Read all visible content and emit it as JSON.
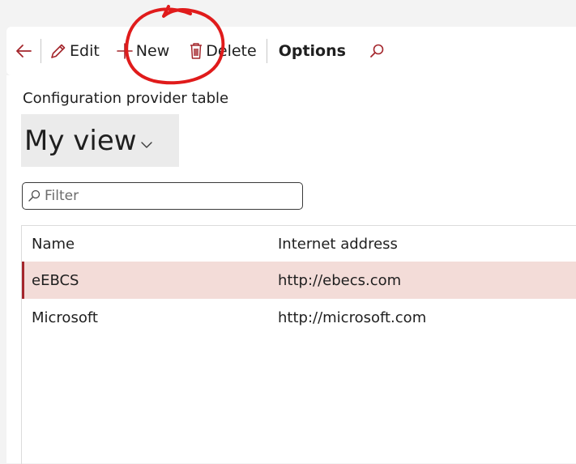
{
  "toolbar": {
    "edit_label": "Edit",
    "new_label": "New",
    "delete_label": "Delete",
    "options_label": "Options"
  },
  "page": {
    "subtitle": "Configuration provider table",
    "view_title": "My view"
  },
  "filter": {
    "placeholder": "Filter"
  },
  "grid": {
    "columns": {
      "name": "Name",
      "address": "Internet address"
    },
    "rows": [
      {
        "name": "eEBCS",
        "address": "http://ebecs.com",
        "selected": true
      },
      {
        "name": "Microsoft",
        "address": "http://microsoft.com",
        "selected": false
      }
    ]
  },
  "colors": {
    "accent": "#a4262c",
    "selected_row": "#f3dcd8",
    "annotation_circle": "#e01b1b"
  },
  "icons": [
    "back-arrow-icon",
    "pencil-icon",
    "plus-icon",
    "trash-icon",
    "search-icon",
    "chevron-down-icon"
  ]
}
